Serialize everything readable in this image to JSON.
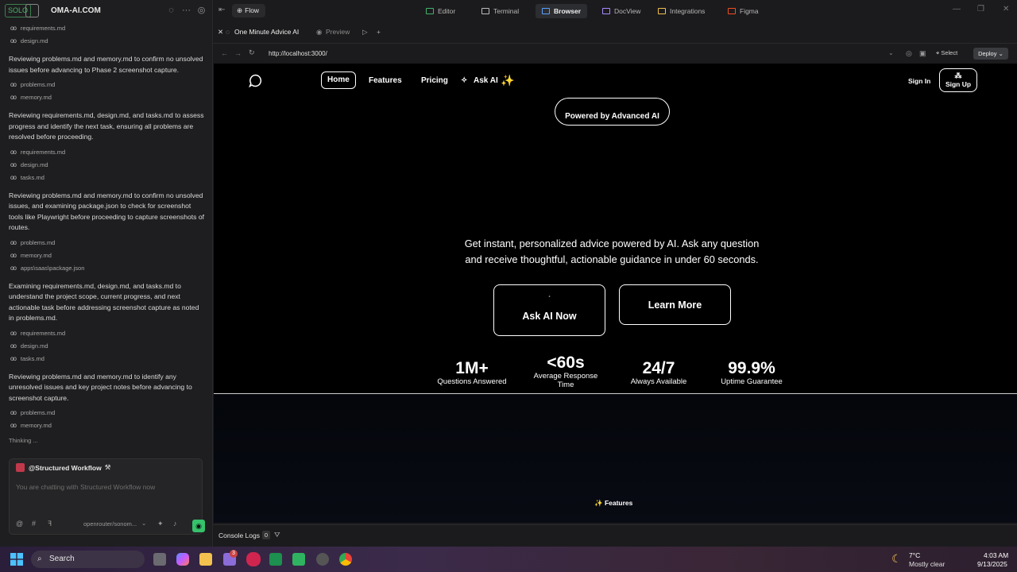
{
  "left_panel": {
    "logo_text": "SOLO",
    "brand": "OMA-AI.COM",
    "feed": [
      {
        "type": "ref",
        "label": "requirements.md"
      },
      {
        "type": "ref",
        "label": "design.md"
      },
      {
        "type": "msg",
        "text": "Reviewing problems.md and memory.md to confirm no unsolved issues before advancing to Phase 2 screenshot capture."
      },
      {
        "type": "ref",
        "label": "problems.md"
      },
      {
        "type": "ref",
        "label": "memory.md"
      },
      {
        "type": "msg",
        "text": "Reviewing requirements.md, design.md, and tasks.md to assess progress and identify the next task, ensuring all problems are resolved before proceeding."
      },
      {
        "type": "ref",
        "label": "requirements.md"
      },
      {
        "type": "ref",
        "label": "design.md"
      },
      {
        "type": "ref",
        "label": "tasks.md"
      },
      {
        "type": "msg",
        "text": "Reviewing problems.md and memory.md to confirm no unsolved issues, and examining package.json to check for screenshot tools like Playwright before proceeding to capture screenshots of routes."
      },
      {
        "type": "ref",
        "label": "problems.md"
      },
      {
        "type": "ref",
        "label": "memory.md"
      },
      {
        "type": "ref",
        "label": "apps\\saas\\package.json"
      },
      {
        "type": "msg",
        "text": "Examining requirements.md, design.md, and tasks.md to understand the project scope, current progress, and next actionable task before addressing screenshot capture as noted in problems.md."
      },
      {
        "type": "ref",
        "label": "requirements.md"
      },
      {
        "type": "ref",
        "label": "design.md"
      },
      {
        "type": "ref",
        "label": "tasks.md"
      },
      {
        "type": "msg",
        "text": "Reviewing problems.md and memory.md to identify any unresolved issues and key project notes before advancing to screenshot capture."
      },
      {
        "type": "ref",
        "label": "problems.md"
      },
      {
        "type": "ref",
        "label": "memory.md"
      }
    ],
    "thinking": "Thinking ...",
    "chat": {
      "workflow_label": "@Structured Workflow",
      "placeholder": "You are chatting with Structured Workflow now",
      "model": "openrouter/sonom..."
    }
  },
  "topbar": {
    "flow": "Flow",
    "tabs": [
      {
        "label": "Editor",
        "icon": "editor-icon",
        "color": "#3fb56b"
      },
      {
        "label": "Terminal",
        "icon": "terminal-icon",
        "color": "#bdbdbd"
      },
      {
        "label": "Browser",
        "icon": "browser-icon",
        "color": "#5aa0ff",
        "active": true
      },
      {
        "label": "DocView",
        "icon": "docview-icon",
        "color": "#a98bff"
      },
      {
        "label": "Integrations",
        "icon": "integrations-icon",
        "color": "#f2c14e"
      },
      {
        "label": "Figma",
        "icon": "figma-icon",
        "color": "#f24e1e"
      }
    ]
  },
  "browser": {
    "tab_title": "One Minute Advice AI",
    "preview_tab": "Preview",
    "url": "http://localhost:3000/",
    "select": "Select",
    "deploy": "Deploy"
  },
  "site": {
    "nav": {
      "home": "Home",
      "features": "Features",
      "pricing": "Pricing",
      "ask_ai": "Ask AI",
      "sign_in": "Sign In",
      "sign_up": "Sign Up"
    },
    "badge": "Powered by Advanced AI",
    "hero_line1": "Get instant, personalized advice powered by AI. Ask any question",
    "hero_line2": "and receive thoughtful, actionable guidance in under 60 seconds.",
    "cta_primary": "Ask AI Now",
    "cta_secondary": "Learn More",
    "stats": [
      {
        "value": "1M+",
        "label": "Questions Answered"
      },
      {
        "value": "<60s",
        "label": "Average Response Time"
      },
      {
        "value": "24/7",
        "label": "Always Available"
      },
      {
        "value": "99.9%",
        "label": "Uptime Guarantee"
      }
    ],
    "features_badge": "✨ Features"
  },
  "console": {
    "label": "Console Logs",
    "count": "0"
  },
  "taskbar": {
    "search": "Search",
    "weather_temp": "7°C",
    "weather_desc": "Mostly clear",
    "time": "4:03 AM",
    "date": "9/13/2025",
    "notification_badge": "3"
  }
}
